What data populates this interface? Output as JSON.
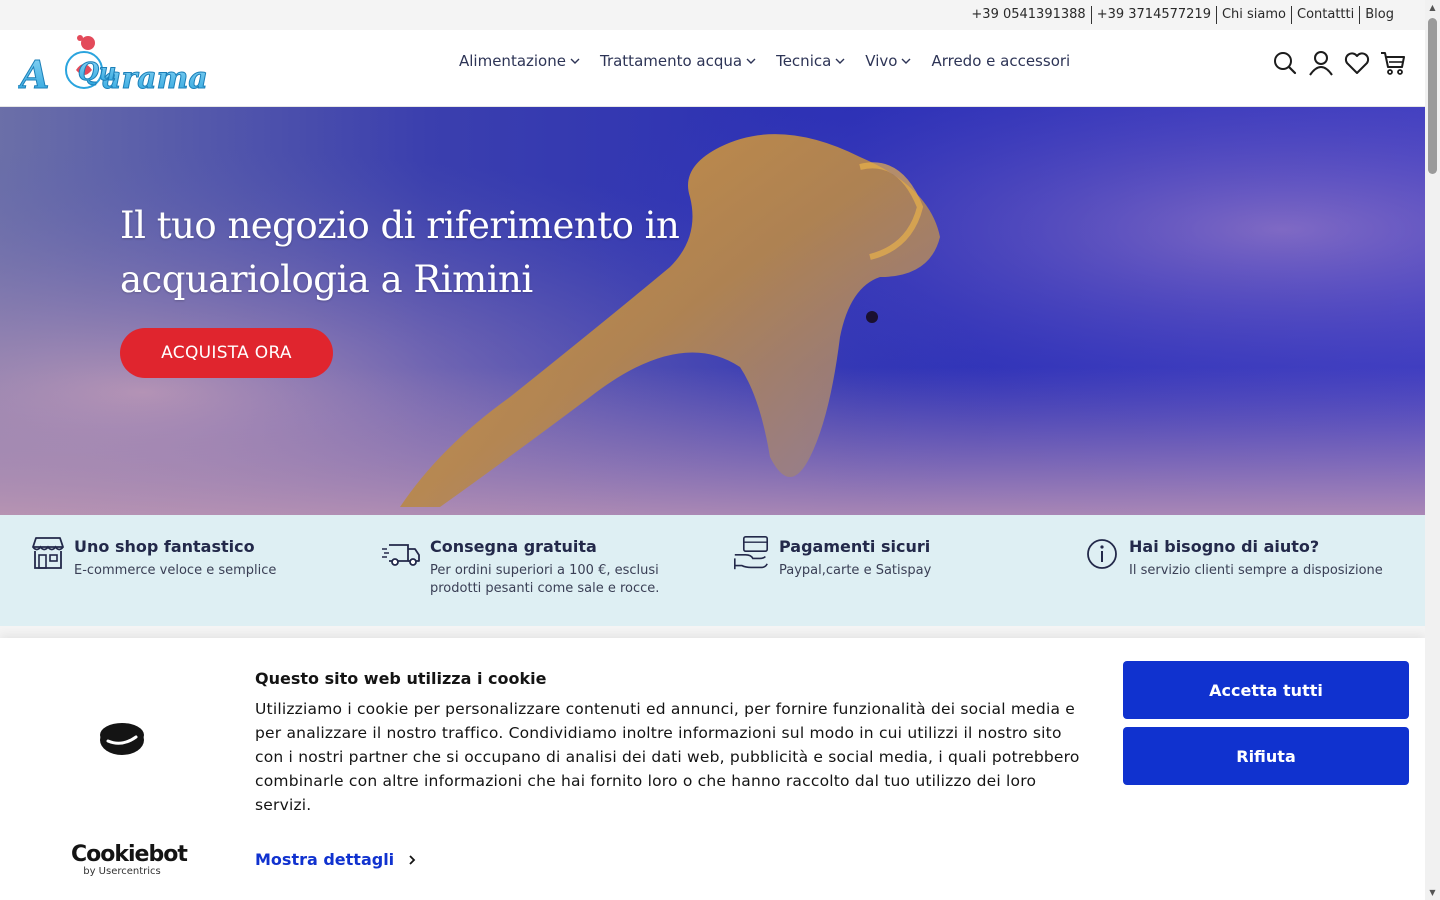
{
  "topbar": {
    "links": [
      "+39 0541391388",
      "+39 3714577219",
      "Chi siamo",
      "Contattti",
      "Blog"
    ]
  },
  "header": {
    "logo_text": "AQuarama",
    "nav": [
      {
        "label": "Alimentazione",
        "dropdown": true
      },
      {
        "label": "Trattamento acqua",
        "dropdown": true
      },
      {
        "label": "Tecnica",
        "dropdown": true
      },
      {
        "label": "Vivo",
        "dropdown": true
      },
      {
        "label": "Arredo e accessori",
        "dropdown": false
      }
    ],
    "icons": [
      "search-icon",
      "user-icon",
      "heart-icon",
      "cart-icon"
    ]
  },
  "hero": {
    "title": "Il tuo negozio di riferimento in acquariologia a Rimini",
    "button_label": "ACQUISTA ORA",
    "button_color": "#e0252e"
  },
  "features": [
    {
      "icon": "store-icon",
      "title": "Uno shop fantastico",
      "desc": "E-commerce veloce e semplice"
    },
    {
      "icon": "truck-icon",
      "title": "Consegna gratuita",
      "desc": "Per ordini superiori a 100 €, esclusi prodotti pesanti come sale e rocce."
    },
    {
      "icon": "payment-icon",
      "title": "Pagamenti sicuri",
      "desc": "Paypal,carte e Satispay"
    },
    {
      "icon": "info-icon",
      "title": "Hai bisogno di aiuto?",
      "desc": "Il servizio clienti sempre a disposizione"
    }
  ],
  "cookie": {
    "title": "Questo sito web utilizza i cookie",
    "text": "Utilizziamo i cookie per personalizzare contenuti ed annunci, per fornire funzionalità dei social media e per analizzare il nostro traffico. Condividiamo inoltre informazioni sul modo in cui utilizzi il nostro sito con i nostri partner che si occupano di analisi dei dati web, pubblicità e social media, i quali potrebbero combinarle con altre informazioni che hai fornito loro o che hanno raccolto dal tuo utilizzo dei loro servizi.",
    "details_label": "Mostra dettagli",
    "accept_label": "Accetta tutti",
    "reject_label": "Rifiuta",
    "brand": "Cookiebot",
    "brand_sub": "by Usercentrics",
    "accent": "#1032cf"
  }
}
